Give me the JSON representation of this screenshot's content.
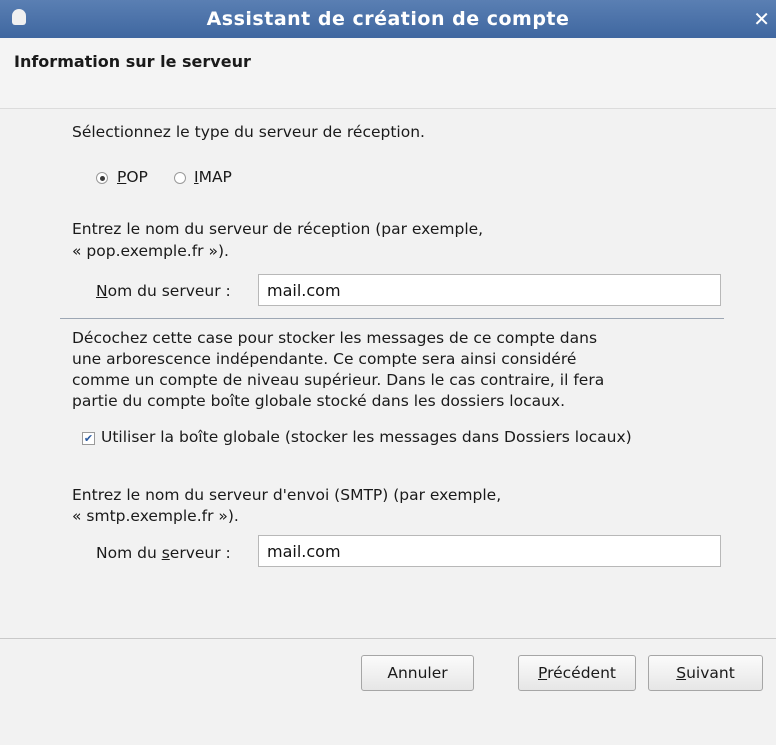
{
  "window": {
    "title": "Assistant de création de compte",
    "close_glyph": "✕"
  },
  "header": {
    "heading": "Information sur le serveur"
  },
  "incoming": {
    "type_prompt": "Sélectionnez le type du serveur de réception.",
    "options": [
      {
        "label": "POP",
        "selected": true
      },
      {
        "label": "IMAP",
        "selected": false
      }
    ],
    "name_prompt_line1": "Entrez le nom du serveur de réception (par exemple,",
    "name_prompt_line2": "« pop.exemple.fr »).",
    "server_label": "Nom du serveur :",
    "server_value": "mail.com"
  },
  "global_inbox": {
    "description_lines": [
      "Décochez cette case pour stocker les messages de ce compte dans",
      "une arborescence indépendante. Ce compte sera ainsi considéré",
      "comme un compte de niveau supérieur. Dans le cas contraire, il fera",
      "partie du compte boîte globale stocké dans les dossiers locaux."
    ],
    "checkbox_label": "Utiliser la boîte globale (stocker les messages dans Dossiers locaux)",
    "checked": true
  },
  "outgoing": {
    "name_prompt_line1": "Entrez le nom du serveur d'envoi (SMTP) (par exemple,",
    "name_prompt_line2": "« smtp.exemple.fr »).",
    "server_label": "Nom du serveur :",
    "server_value": "mail.com"
  },
  "buttons": {
    "cancel": "Annuler",
    "previous": "Précédent",
    "next": "Suivant"
  }
}
